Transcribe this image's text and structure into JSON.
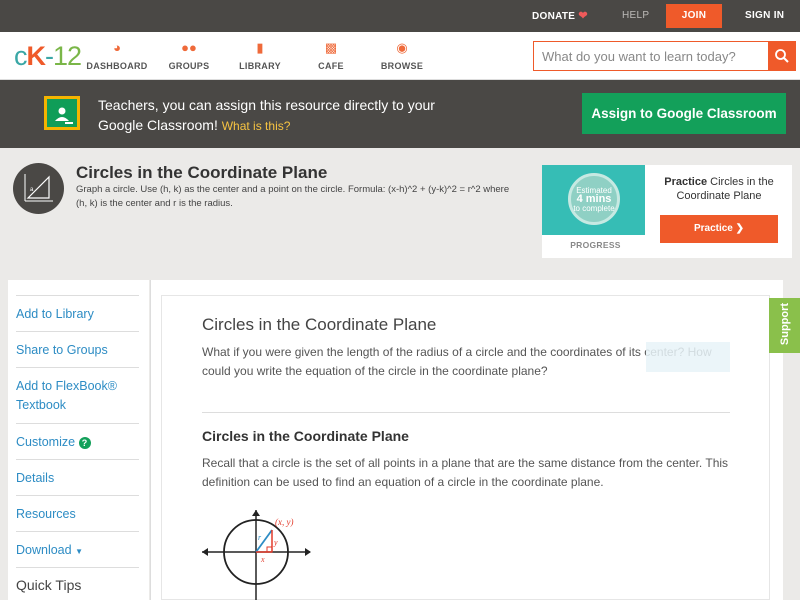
{
  "topbar": {
    "donate": "DONATE",
    "help": "HELP",
    "join": "JOIN",
    "signin": "SIGN IN"
  },
  "logo": {
    "c": "c",
    "k": "K",
    "dash": "-",
    "num": "12"
  },
  "nav": {
    "dashboard": "DASHBOARD",
    "groups": "GROUPS",
    "library": "LIBRARY",
    "cafe": "CAFE",
    "browse": "BROWSE"
  },
  "search": {
    "placeholder": "What do you want to learn today?"
  },
  "classroom": {
    "text": "Teachers, you can assign this resource directly to your Google Classroom!",
    "what": "What is this?",
    "button": "Assign to Google Classroom"
  },
  "concept": {
    "title": "Circles in the Coordinate Plane",
    "description": "Graph a circle. Use (h, k) as the center and a point on the circle. Formula: (x-h)^2 + (y-k)^2 = r^2 where (h, k) is the center and r is the radius."
  },
  "practice": {
    "estimated": "Estimated",
    "mins": "4 mins",
    "to_complete": "to complete",
    "progress_label": "PROGRESS",
    "title_bold": "Practice",
    "title_rest": "Circles in the Coordinate Plane",
    "button": "Practice"
  },
  "sidebar": {
    "items": [
      {
        "label": "Add to Library"
      },
      {
        "label": "Share to Groups"
      },
      {
        "label": "Add to FlexBook®"
      },
      {
        "label": "Textbook"
      },
      {
        "label": "Customize"
      },
      {
        "label": "Details"
      },
      {
        "label": "Resources"
      },
      {
        "label": "Download"
      }
    ],
    "quick_tips": "Quick Tips"
  },
  "content": {
    "heading": "Circles in the Coordinate Plane",
    "intro": "What if you were given the length of the radius of a circle and the coordinates of its center? How could you write the equation of the circle in the coordinate plane?",
    "section_heading": "Circles in the Coordinate Plane",
    "section_text": "Recall that a circle is the set of all points in a plane that are the same distance from the center. This definition can be used to find an equation of a circle in the coordinate plane.",
    "graph": {
      "point": "(x, y)",
      "r": "r",
      "x": "x",
      "y": "y"
    }
  },
  "support": "Support",
  "colors": {
    "brand_orange": "#ef5a2a",
    "google_green": "#13a05a",
    "link_blue": "#2d8cc4",
    "dark_bar": "#4a4845"
  }
}
